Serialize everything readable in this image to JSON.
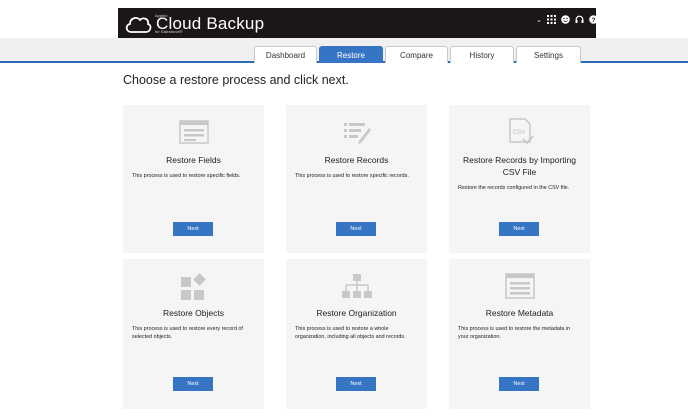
{
  "app": {
    "brand": "Cloud Backup",
    "brand_small_top": "Appirio",
    "brand_small_bottom": "for Salesforce®",
    "top_icons": [
      "chevron-down-icon",
      "apps-grid-icon",
      "smiley-icon",
      "headset-icon",
      "help-icon",
      "tools-icon"
    ]
  },
  "tabs": [
    {
      "label": "Dashboard",
      "active": false
    },
    {
      "label": "Restore",
      "active": true
    },
    {
      "label": "Compare",
      "active": false
    },
    {
      "label": "History",
      "active": false
    },
    {
      "label": "Settings",
      "active": false
    }
  ],
  "page_title": "Choose a restore process and click next.",
  "cards": [
    {
      "title": "Restore Fields",
      "description": "This process is used to restore specific fields.",
      "button": "Next",
      "icon": "fields-form-icon"
    },
    {
      "title": "Restore Records",
      "description": "This process is used to restore specific records.",
      "button": "Next",
      "icon": "records-edit-icon"
    },
    {
      "title": "Restore Records by Importing CSV File",
      "description": "Restore the records configured in the CSV file.",
      "button": "Next",
      "icon": "csv-file-icon"
    },
    {
      "title": "Restore Objects",
      "description": "This process is used to restore every record of selected objects.",
      "button": "Next",
      "icon": "objects-shapes-icon"
    },
    {
      "title": "Restore Organization",
      "description": "This process is used to restore a whole organization, including all objects and records.",
      "button": "Next",
      "icon": "org-hierarchy-icon"
    },
    {
      "title": "Restore Metadata",
      "description": "This process is used to restore the metadata in your organization.",
      "button": "Next",
      "icon": "metadata-list-icon"
    }
  ],
  "colors": {
    "accent": "#3675c4",
    "topbar": "#1c1717",
    "icon_gray": "#cccccc"
  }
}
